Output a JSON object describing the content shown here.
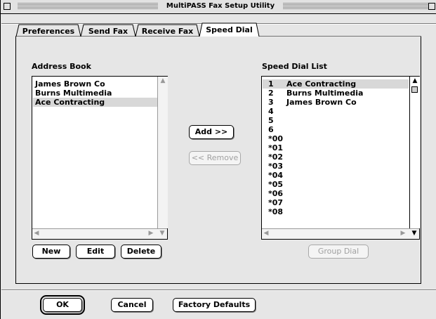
{
  "window": {
    "title": "MultiPASS Fax Setup Utility"
  },
  "tabs": [
    {
      "label": "Preferences"
    },
    {
      "label": "Send Fax"
    },
    {
      "label": "Receive Fax"
    },
    {
      "label": "Speed Dial",
      "active": true
    }
  ],
  "address_book": {
    "label": "Address Book",
    "items": [
      "James Brown Co",
      "Burns Multimedia",
      "Ace Contracting"
    ],
    "selected_index": 2
  },
  "speed_dial": {
    "label": "Speed Dial List",
    "rows": [
      {
        "num": "1",
        "name": "Ace Contracting"
      },
      {
        "num": "2",
        "name": "Burns Multimedia"
      },
      {
        "num": "3",
        "name": "James Brown Co"
      },
      {
        "num": "4",
        "name": ""
      },
      {
        "num": "5",
        "name": ""
      },
      {
        "num": "6",
        "name": ""
      },
      {
        "num": "*00",
        "name": ""
      },
      {
        "num": "*01",
        "name": ""
      },
      {
        "num": "*02",
        "name": ""
      },
      {
        "num": "*03",
        "name": ""
      },
      {
        "num": "*04",
        "name": ""
      },
      {
        "num": "*05",
        "name": ""
      },
      {
        "num": "*06",
        "name": ""
      },
      {
        "num": "*07",
        "name": ""
      },
      {
        "num": "*08",
        "name": ""
      }
    ],
    "selected_index": 0
  },
  "buttons": {
    "add": "Add >>",
    "remove": "<< Remove",
    "new": "New",
    "edit": "Edit",
    "delete": "Delete",
    "group_dial": "Group Dial",
    "ok": "OK",
    "cancel": "Cancel",
    "factory_defaults": "Factory Defaults"
  },
  "icons": {
    "close": "close-box-icon",
    "zoom": "zoom-box-icon",
    "scroll_up": "arrow-up-icon",
    "scroll_down": "arrow-down-icon",
    "scroll_left": "arrow-left-icon",
    "scroll_right": "arrow-right-icon"
  },
  "colors": {
    "window_bg": "#e6e6e6",
    "selection": "#d8d8d8",
    "disabled_text": "#a0a0a0"
  }
}
